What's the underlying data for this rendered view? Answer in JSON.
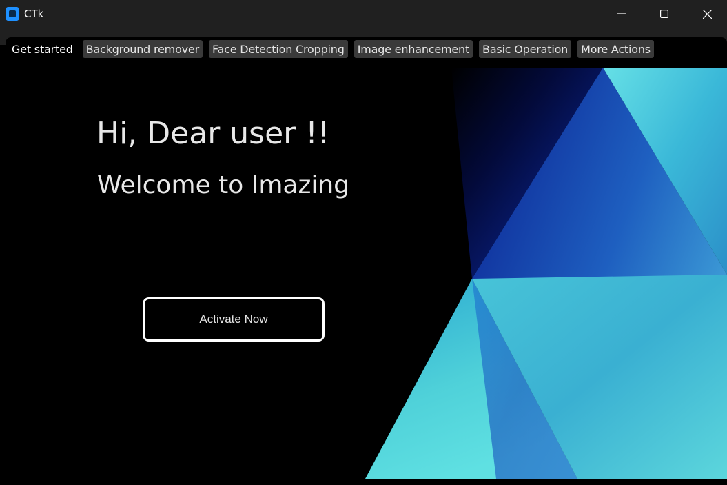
{
  "window": {
    "title": "CTk",
    "icon": "app-icon",
    "controls": [
      "minimize-icon",
      "maximize-icon",
      "close-icon"
    ]
  },
  "tabs": [
    {
      "label": "Get started",
      "active": true
    },
    {
      "label": "Background remover",
      "active": false
    },
    {
      "label": "Face Detection Cropping",
      "active": false
    },
    {
      "label": "Image enhancement",
      "active": false
    },
    {
      "label": "Basic Operation",
      "active": false
    },
    {
      "label": "More Actions",
      "active": false
    }
  ],
  "content": {
    "greeting": "Hi, Dear user !!",
    "welcome": "Welcome to Imazing",
    "activate_label": "Activate Now"
  },
  "colors": {
    "titlebar": "#202020",
    "background": "#000000",
    "tab_inactive": "#3a3a3a",
    "accent_blue": "#1e90ff",
    "wallpaper_cyan": "#4fd1d9",
    "wallpaper_navy": "#0a1f8f"
  }
}
